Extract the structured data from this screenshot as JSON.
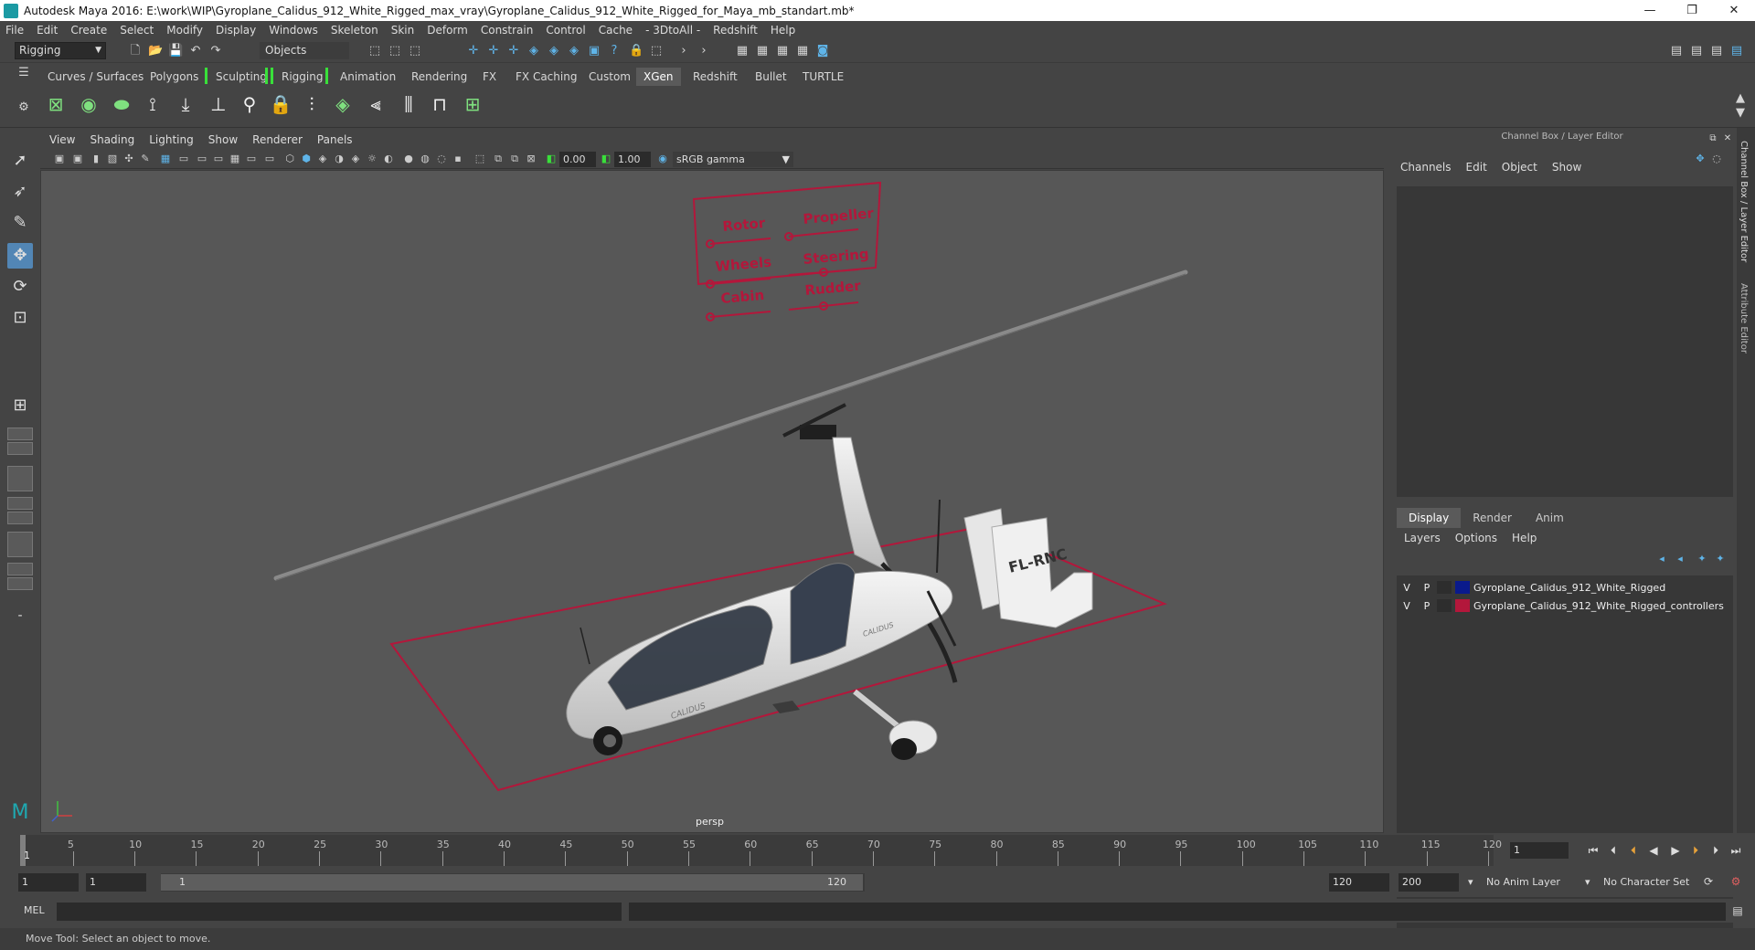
{
  "window": {
    "title": "Autodesk Maya 2016: E:\\work\\WIP\\Gyroplane_Calidus_912_White_Rigged_max_vray\\Gyroplane_Calidus_912_White_Rigged_for_Maya_mb_standart.mb*",
    "minimize": "—",
    "restore": "❐",
    "close": "✕"
  },
  "menubar": [
    "File",
    "Edit",
    "Create",
    "Select",
    "Modify",
    "Display",
    "Windows",
    "Skeleton",
    "Skin",
    "Deform",
    "Constrain",
    "Control",
    "Cache",
    "- 3DtoAll -",
    "Redshift",
    "Help"
  ],
  "statusline": {
    "mode": "Rigging",
    "selection_mode": "Objects"
  },
  "shelf_tabs": [
    {
      "label": "Curves / Surfaces",
      "active": false
    },
    {
      "label": "Polygons",
      "active": false
    },
    {
      "label": "Sculpting",
      "active": false
    },
    {
      "label": "Rigging",
      "active": false
    },
    {
      "label": "Animation",
      "active": false
    },
    {
      "label": "Rendering",
      "active": false
    },
    {
      "label": "FX",
      "active": false
    },
    {
      "label": "FX Caching",
      "active": false
    },
    {
      "label": "Custom",
      "active": false
    },
    {
      "label": "XGen",
      "active": true
    },
    {
      "label": "Redshift",
      "active": false
    },
    {
      "label": "Bullet",
      "active": false
    },
    {
      "label": "TURTLE",
      "active": false
    }
  ],
  "viewport": {
    "menu": [
      "View",
      "Shading",
      "Lighting",
      "Show",
      "Renderer",
      "Panels"
    ],
    "exposure": "0.00",
    "gamma": "1.00",
    "color_space": "sRGB gamma",
    "camera": "persp",
    "controller_labels": {
      "rotor": "Rotor",
      "propeller": "Propeller",
      "wheels": "Wheels",
      "steering": "Steering",
      "cabin": "Cabin",
      "rudder": "Rudder"
    },
    "tail_text": "FL-RNC",
    "body_text": "CALIDUS",
    "controller_color": "#b3173b"
  },
  "channel_box": {
    "title": "Channel Box / Layer Editor",
    "menu": [
      "Channels",
      "Edit",
      "Object",
      "Show"
    ]
  },
  "layer_editor": {
    "tabs": [
      {
        "label": "Display",
        "active": true
      },
      {
        "label": "Render",
        "active": false
      },
      {
        "label": "Anim",
        "active": false
      }
    ],
    "menu": [
      "Layers",
      "Options",
      "Help"
    ],
    "layers": [
      {
        "v": "V",
        "p": "P",
        "color": "#0a1a8c",
        "name": "Gyroplane_Calidus_912_White_Rigged"
      },
      {
        "v": "V",
        "p": "P",
        "color": "#b3173b",
        "name": "Gyroplane_Calidus_912_White_Rigged_controllers"
      }
    ]
  },
  "side_tabs": [
    "Channel Box / Layer Editor",
    "Attribute Editor"
  ],
  "timeline": {
    "ticks": [
      5,
      10,
      15,
      20,
      25,
      30,
      35,
      40,
      45,
      50,
      55,
      60,
      65,
      70,
      75,
      80,
      85,
      90,
      95,
      100,
      105,
      110,
      115,
      120
    ],
    "current_frame": "1",
    "current_field": "1"
  },
  "range": {
    "start": "1",
    "anim_start": "1",
    "slider_start": "1",
    "slider_end": "120",
    "end": "120",
    "anim_end": "200",
    "anim_layer": "No Anim Layer",
    "character_set": "No Character Set"
  },
  "command_line": {
    "label": "MEL"
  },
  "help_line": "Move Tool: Select an object to move."
}
